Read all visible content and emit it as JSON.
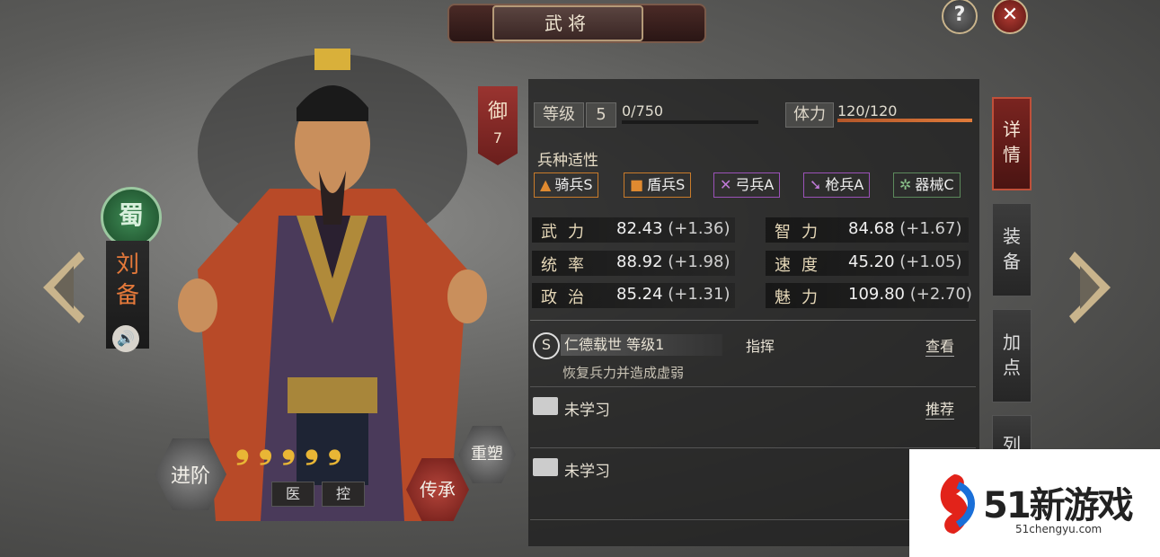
{
  "header": {
    "title": "武将"
  },
  "buttons": {
    "help": "?",
    "close": "✕"
  },
  "hero": {
    "faction": "蜀",
    "name": "刘备",
    "role": "御",
    "role_value": "7",
    "stars": [
      "❟",
      "❟",
      "❟",
      "❟",
      "❟"
    ],
    "traits": [
      "医",
      "控"
    ]
  },
  "actions": {
    "advance": "进阶",
    "inherit": "传承",
    "rebirth": "重塑"
  },
  "level": {
    "label": "等级",
    "value": "5",
    "exp_text": "0/750",
    "exp_fraction": 0.0
  },
  "stamina": {
    "label": "体力",
    "text": "120/120",
    "fraction": 1.0
  },
  "troop": {
    "title": "兵种适性",
    "types": [
      {
        "label": "骑兵S",
        "color": "#c97b2a",
        "icon": "horse-icon"
      },
      {
        "label": "盾兵S",
        "color": "#c97b2a",
        "icon": "shield-icon"
      },
      {
        "label": "弓兵A",
        "color": "#9b52b8",
        "icon": "bow-icon"
      },
      {
        "label": "枪兵A",
        "color": "#9b52b8",
        "icon": "spear-icon"
      },
      {
        "label": "器械C",
        "color": "#5c8a5c",
        "icon": "machine-icon"
      }
    ]
  },
  "attributes": [
    {
      "name": "武力",
      "value": "82.43",
      "delta": "(+1.36)"
    },
    {
      "name": "智力",
      "value": "84.68",
      "delta": "(+1.67)"
    },
    {
      "name": "统率",
      "value": "88.92",
      "delta": "(+1.98)"
    },
    {
      "name": "速度",
      "value": "45.20",
      "delta": "(+1.05)"
    },
    {
      "name": "政治",
      "value": "85.24",
      "delta": "(+1.31)"
    },
    {
      "name": "魅力",
      "value": "109.80",
      "delta": "(+2.70)"
    }
  ],
  "skills": {
    "main": {
      "grade": "S",
      "name": "仁德载世 等级1",
      "type": "指挥",
      "link": "查看",
      "desc": "恢复兵力并造成虚弱"
    },
    "slot1": {
      "name": "未学习",
      "link": "推荐"
    },
    "slot2": {
      "name": "未学习"
    }
  },
  "side_tabs": [
    "详情",
    "装备",
    "加点",
    "列"
  ],
  "watermark": {
    "text": "51新游戏",
    "url": "51chengyu.com"
  }
}
